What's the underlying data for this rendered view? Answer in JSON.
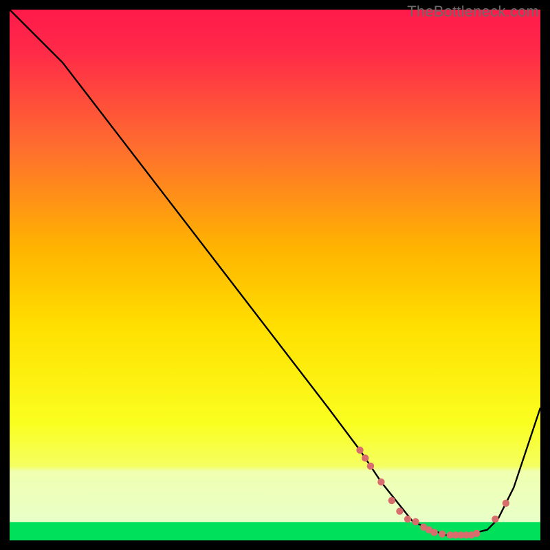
{
  "watermark": "TheBottleneck.com",
  "colors": {
    "gradient_top": "#ff1a4a",
    "gradient_mid1": "#ff7030",
    "gradient_mid2": "#ffd400",
    "gradient_mid3": "#f6ff3a",
    "gradient_bottom_band": "#e8ffb0",
    "green_band": "#00e05a",
    "line": "#000000",
    "marker": "#d86d6d",
    "background": "#000000"
  },
  "chart_data": {
    "type": "line",
    "title": "",
    "xlabel": "",
    "ylabel": "",
    "xlim": [
      0,
      100
    ],
    "ylim": [
      0,
      100
    ],
    "green_band_y": [
      0,
      3
    ],
    "pale_band_y": [
      3,
      14
    ],
    "series": [
      {
        "name": "bottleneck-curve",
        "x": [
          0,
          8,
          10,
          20,
          30,
          40,
          50,
          60,
          66,
          70,
          76,
          82,
          86,
          90,
          92,
          95,
          100
        ],
        "y": [
          100,
          92,
          90,
          77,
          64,
          51,
          38,
          25,
          17,
          11,
          3.5,
          1,
          1,
          2,
          4,
          10,
          25
        ]
      }
    ],
    "markers": {
      "name": "highlight-points",
      "x": [
        66,
        67,
        68,
        70,
        72,
        73.5,
        75,
        76.5,
        78,
        79,
        80,
        81.5,
        83,
        84,
        85,
        86,
        87,
        88,
        91.5,
        93.5
      ],
      "y": [
        17,
        15.5,
        14,
        11,
        7.5,
        5.5,
        4,
        3.5,
        2.5,
        2,
        1.5,
        1.2,
        1,
        1,
        1,
        1,
        1,
        1.3,
        4,
        7
      ]
    }
  }
}
